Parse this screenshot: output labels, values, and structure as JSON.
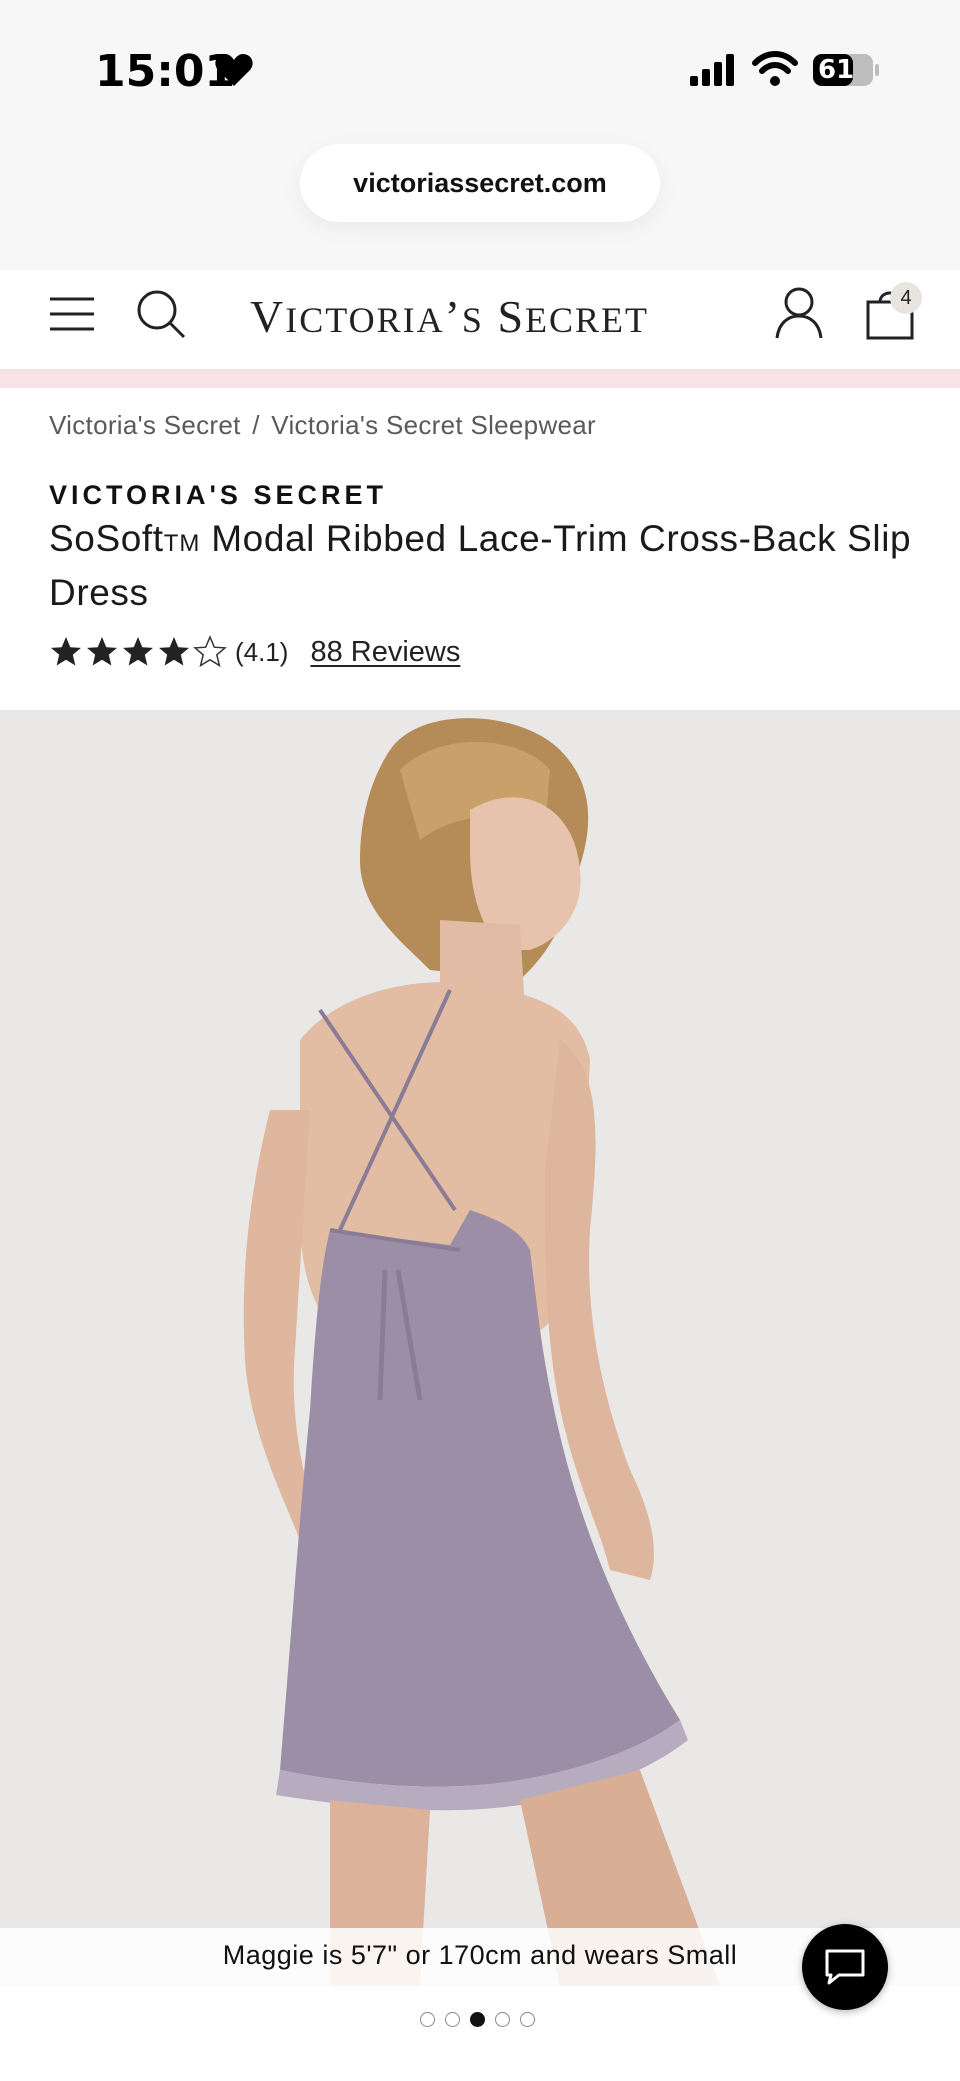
{
  "status_bar": {
    "time": "15:01",
    "battery": "61"
  },
  "browser": {
    "url": "victoriassecret.com"
  },
  "header": {
    "brand": "Victoria's Secret",
    "cart_count": "4"
  },
  "breadcrumb": {
    "items": [
      "Victoria's Secret",
      "Victoria's Secret Sleepwear"
    ],
    "separator": "/"
  },
  "product": {
    "brand": "VICTORIA'S SECRET",
    "title_part1": "SoSoft",
    "title_tm": "TM",
    "title_part2": " Modal Ribbed Lace-Trim Cross-Back Slip Dress",
    "rating_value": 4.1,
    "rating_text": "(4.1)",
    "reviews_label": "88 Reviews",
    "model_caption": "Maggie is 5'7\" or 170cm and wears Small"
  },
  "gallery": {
    "count": 5,
    "active_index": 2
  },
  "colors": {
    "pink_strip": "#f8e1e7",
    "dress": "#9b8ea6",
    "image_bg": "#e9e8e6"
  }
}
